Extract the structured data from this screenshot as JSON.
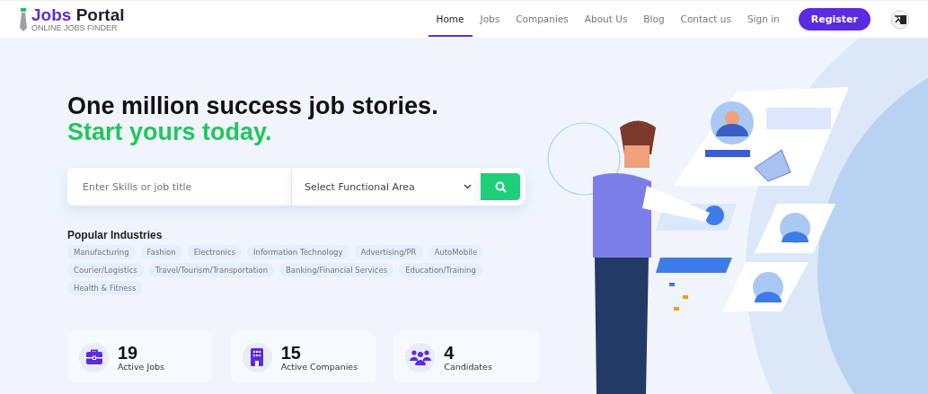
{
  "header": {
    "logo": {
      "name_first": "Jobs",
      "name_second": "Portal",
      "tagline": "ONLINE JOBS FINDER"
    },
    "nav": [
      {
        "label": "Home",
        "selected": true
      },
      {
        "label": "Jobs",
        "selected": false
      },
      {
        "label": "Companies",
        "selected": false
      },
      {
        "label": "About Us",
        "selected": false
      },
      {
        "label": "Blog",
        "selected": false
      },
      {
        "label": "Contact us",
        "selected": false
      },
      {
        "label": "Sign in",
        "selected": false
      }
    ],
    "register_button": "Register"
  },
  "hero": {
    "headline_line1": "One million success job stories.",
    "headline_line2": "Start yours today.",
    "search": {
      "placeholder": "Enter Skills or job title",
      "select_label": "Select Functional Area"
    },
    "popular_industries": {
      "title": "Popular Industries",
      "tags": [
        "Manufacturing",
        "Fashion",
        "Electronics",
        "Information Technology",
        "Advertising/PR",
        "AutoMobile",
        "Courier/Logistics",
        "Travel/Tourism/Transportation",
        "Banking/Financial Services",
        "Education/Training",
        "Health & Fitness"
      ]
    },
    "stats": [
      {
        "kind": "jobs",
        "value": "19",
        "label": "Active Jobs"
      },
      {
        "kind": "companies",
        "value": "15",
        "label": "Active Companies"
      },
      {
        "kind": "candidates",
        "value": "4",
        "label": "Candidates"
      }
    ]
  }
}
